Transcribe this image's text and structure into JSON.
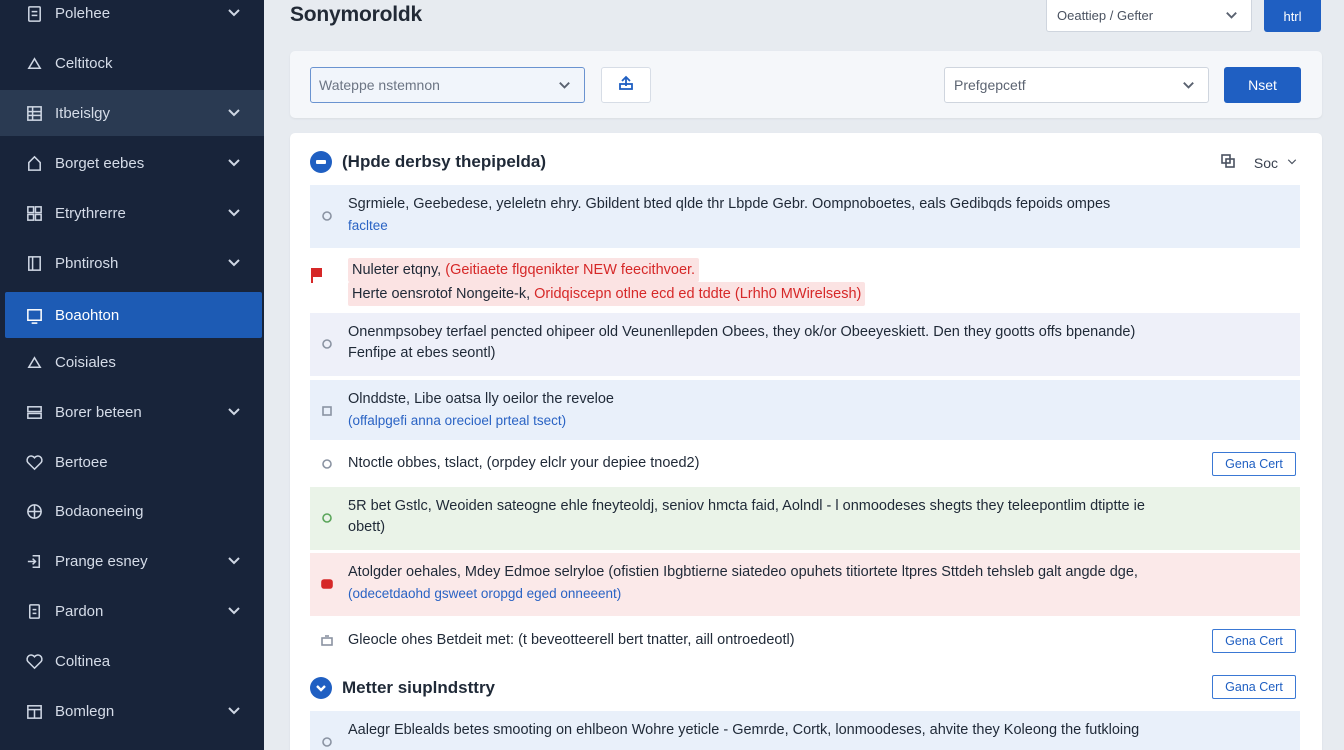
{
  "sidebar": {
    "items": [
      {
        "label": "Polehee",
        "icon": "clipboard-icon",
        "chevron": true
      },
      {
        "label": "Celtitock",
        "icon": "cloud-icon",
        "chevron": false
      },
      {
        "label": "Itbeislgy",
        "icon": "list-icon",
        "chevron": true
      },
      {
        "label": "Borget eebes",
        "icon": "home-icon",
        "chevron": true
      },
      {
        "label": "Etrythrerre",
        "icon": "grid-icon",
        "chevron": true
      },
      {
        "label": "Pbntirosh",
        "icon": "book-icon",
        "chevron": true
      },
      {
        "label": "Boaohton",
        "icon": "monitor-icon",
        "chevron": false
      },
      {
        "label": "Coisiales",
        "icon": "cloud-icon",
        "chevron": false
      },
      {
        "label": "Borer beteen",
        "icon": "server-icon",
        "chevron": true
      },
      {
        "label": "Bertoee",
        "icon": "heart-icon",
        "chevron": false
      },
      {
        "label": "Bodaoneeing",
        "icon": "globe-icon",
        "chevron": false
      },
      {
        "label": "Prange esney",
        "icon": "login-icon",
        "chevron": true
      },
      {
        "label": "Pardon",
        "icon": "document-icon",
        "chevron": true
      },
      {
        "label": "Coltinea",
        "icon": "heart-icon",
        "chevron": false
      },
      {
        "label": "Bomlegn",
        "icon": "calendar-icon",
        "chevron": true
      }
    ]
  },
  "header": {
    "title": "Sonymoroldk",
    "select_value": "Oeattiep / Gefter",
    "button_label": "htrl"
  },
  "toolbar": {
    "select_value": "Wateppe nstemnon",
    "select2_value": "Prefgepcetf",
    "button_label": "Nset"
  },
  "panel": {
    "section1_title": "(Hpde derbsy thepipelda)",
    "tools_label": "Soc",
    "section2_title": "Metter siuplndsttry",
    "rows": [
      {
        "text": "Sgrmiele, Geebedese, yeleletn ehry. Gbildent bted qlde thr Lbpde Gebr. Oompnoboetes, eals Gedibqds fepoids ompes",
        "sub": "facltee"
      },
      {
        "text": "Onenmpsobey terfael pencted ohipeer old Veunenllepden Obees, they ok/or Obeeyeskiett. Den they gootts offs bpenande)",
        "sub": "Fenfipe at ebes seontl)"
      },
      {
        "text": "Olnddste, Libe oatsa lly oeilor the reveloe",
        "sub": "(offalpgefi anna orecioel prteal tsect)"
      },
      {
        "text": "Ntoctle obbes, tslact, (orpdey elclr your depiee tnoed2)",
        "sub": "",
        "button": "Gena Cert"
      },
      {
        "text": "5R bet Gstlc, Weoiden sateogne ehle fneyteoldj, seniov hmcta faid, Aolndl - l onmoodeses shegts they teleepontlim dtiptte ie",
        "sub": "obett)"
      },
      {
        "text": "Atolgder oehales, Mdey Edmoe selryloe (ofistien Ibgbtierne siatedeo opuhets titiortete ltpres Sttdeh tehsleb galt angde dge,",
        "sub": "(odecetdaohd gsweet oropgd eged onneeent)"
      },
      {
        "text": "Gleocle ohes Betdeit met: (t beveotteerell bert tnatter, aill ontroedeotl)",
        "sub": "",
        "button": "Gena Cert"
      },
      {
        "text": "Aalegr Eblealds betes smooting on ehlbeon Wohre yeticle - Gemrde, Cortk, lonmoodeses, ahvite they Koleong the futkloing",
        "sub": ""
      }
    ],
    "notice": {
      "line1_prefix": "Nuleter etqny,",
      "line1_red": "(Geitiaete flgqenikter NEW feecithvoer.",
      "line2_prefix": "Herte oensrotof Nongeite-k,",
      "line2_red": "Oridqiscepn otlne ecd ed tddte (Lrhh0 MWirelsesh)"
    },
    "section2_button": "Gana Cert"
  },
  "colors": {
    "sidebar_bg": "#18243a",
    "active_blue": "#1d5bb4",
    "accent": "#1f5fc2",
    "error_red": "#d62828"
  }
}
